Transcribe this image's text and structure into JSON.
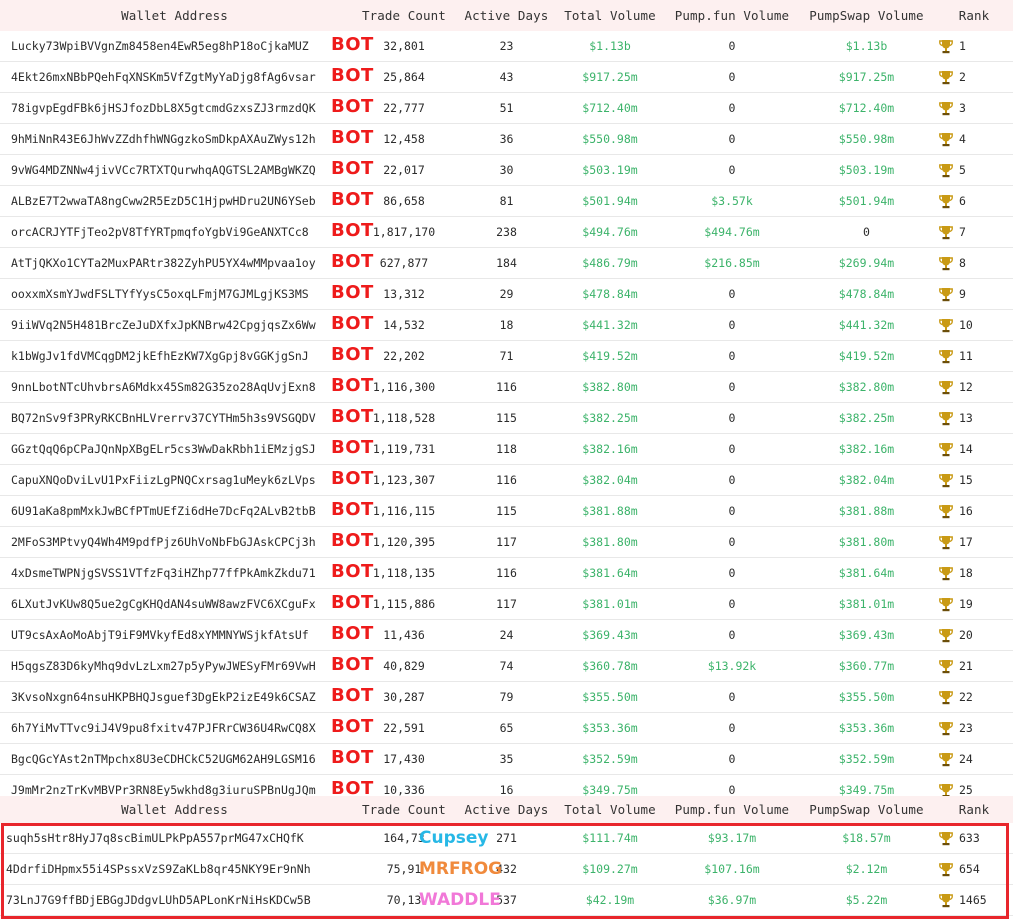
{
  "colors": {
    "green": "#3cb36a",
    "bot": "#ee1b1b",
    "frame": "#e8262c",
    "cupsey": "#27b8e6",
    "mrfrog": "#f08a3c",
    "waddle": "#f178d8",
    "trophy": "#c99a14"
  },
  "headers": {
    "wallet": "Wallet Address",
    "trades": "Trade Count",
    "days": "Active Days",
    "total": "Total Volume",
    "pump": "Pump.fun Volume",
    "swap": "PumpSwap Volume",
    "rank": "Rank"
  },
  "bot_label": "BOT",
  "top_rows": [
    {
      "addr": "Lucky73WpiBVVgnZm8458en4EwR5eg8hP18oCjkaMUZ",
      "trades": "32,801",
      "days": "23",
      "total": "$1.13b",
      "pump": "0",
      "swap": "$1.13b",
      "rank": "1"
    },
    {
      "addr": "4Ekt26mxNBbPQehFqXNSKm5VfZgtMyYaDjg8fAg6vsar",
      "trades": "25,864",
      "days": "43",
      "total": "$917.25m",
      "pump": "0",
      "swap": "$917.25m",
      "rank": "2"
    },
    {
      "addr": "78igvpEgdFBk6jHSJfozDbL8X5gtcmdGzxsZJ3rmzdQK",
      "trades": "22,777",
      "days": "51",
      "total": "$712.40m",
      "pump": "0",
      "swap": "$712.40m",
      "rank": "3"
    },
    {
      "addr": "9hMiNnR43E6JhWvZZdhfhWNGgzkoSmDkpAXAuZWys12h",
      "trades": "12,458",
      "days": "36",
      "total": "$550.98m",
      "pump": "0",
      "swap": "$550.98m",
      "rank": "4"
    },
    {
      "addr": "9vWG4MDZNNw4jivVCc7RTXTQurwhqAQGTSL2AMBgWKZQ",
      "trades": "22,017",
      "days": "30",
      "total": "$503.19m",
      "pump": "0",
      "swap": "$503.19m",
      "rank": "5"
    },
    {
      "addr": "ALBzE7T2wwaTA8ngCww2R5EzD5C1HjpwHDru2UN6YSeb",
      "trades": "86,658",
      "days": "81",
      "total": "$501.94m",
      "pump": "$3.57k",
      "swap": "$501.94m",
      "rank": "6"
    },
    {
      "addr": "orcACRJYTFjTeo2pV8TfYRTpmqfoYgbVi9GeANXTCc8",
      "trades": "1,817,170",
      "days": "238",
      "total": "$494.76m",
      "pump": "$494.76m",
      "swap": "0",
      "rank": "7"
    },
    {
      "addr": "AtTjQKXo1CYTa2MuxPARtr382ZyhPU5YX4wMMpvaa1oy",
      "trades": "627,877",
      "days": "184",
      "total": "$486.79m",
      "pump": "$216.85m",
      "swap": "$269.94m",
      "rank": "8"
    },
    {
      "addr": "ooxxmXsmYJwdFSLTYfYysC5oxqLFmjM7GJMLgjKS3MS",
      "trades": "13,312",
      "days": "29",
      "total": "$478.84m",
      "pump": "0",
      "swap": "$478.84m",
      "rank": "9"
    },
    {
      "addr": "9iiWVq2N5H481BrcZeJuDXfxJpKNBrw42CpgjqsZx6Ww",
      "trades": "14,532",
      "days": "18",
      "total": "$441.32m",
      "pump": "0",
      "swap": "$441.32m",
      "rank": "10"
    },
    {
      "addr": "k1bWgJv1fdVMCqgDM2jkEfhEzKW7XgGpj8vGGKjgSnJ",
      "trades": "22,202",
      "days": "71",
      "total": "$419.52m",
      "pump": "0",
      "swap": "$419.52m",
      "rank": "11"
    },
    {
      "addr": "9nnLbotNTcUhvbrsA6Mdkx45Sm82G35zo28AqUvjExn8",
      "trades": "1,116,300",
      "days": "116",
      "total": "$382.80m",
      "pump": "0",
      "swap": "$382.80m",
      "rank": "12"
    },
    {
      "addr": "BQ72nSv9f3PRyRKCBnHLVrerrv37CYTHm5h3s9VSGQDV",
      "trades": "1,118,528",
      "days": "115",
      "total": "$382.25m",
      "pump": "0",
      "swap": "$382.25m",
      "rank": "13"
    },
    {
      "addr": "GGztQqQ6pCPaJQnNpXBgELr5cs3WwDakRbh1iEMzjgSJ",
      "trades": "1,119,731",
      "days": "118",
      "total": "$382.16m",
      "pump": "0",
      "swap": "$382.16m",
      "rank": "14"
    },
    {
      "addr": "CapuXNQoDviLvU1PxFiizLgPNQCxrsag1uMeyk6zLVps",
      "trades": "1,123,307",
      "days": "116",
      "total": "$382.04m",
      "pump": "0",
      "swap": "$382.04m",
      "rank": "15"
    },
    {
      "addr": "6U91aKa8pmMxkJwBCfPTmUEfZi6dHe7DcFq2ALvB2tbB",
      "trades": "1,116,115",
      "days": "115",
      "total": "$381.88m",
      "pump": "0",
      "swap": "$381.88m",
      "rank": "16"
    },
    {
      "addr": "2MFoS3MPtvyQ4Wh4M9pdfPjz6UhVoNbFbGJAskCPCj3h",
      "trades": "1,120,395",
      "days": "117",
      "total": "$381.80m",
      "pump": "0",
      "swap": "$381.80m",
      "rank": "17"
    },
    {
      "addr": "4xDsmeTWPNjgSVSS1VTfzFq3iHZhp77ffPkAmkZkdu71",
      "trades": "1,118,135",
      "days": "116",
      "total": "$381.64m",
      "pump": "0",
      "swap": "$381.64m",
      "rank": "18"
    },
    {
      "addr": "6LXutJvKUw8Q5ue2gCgKHQdAN4suWW8awzFVC6XCguFx",
      "trades": "1,115,886",
      "days": "117",
      "total": "$381.01m",
      "pump": "0",
      "swap": "$381.01m",
      "rank": "19"
    },
    {
      "addr": "UT9csAxAoMoAbjT9iF9MVkyfEd8xYMMNYWSjkfAtsUf",
      "trades": "11,436",
      "days": "24",
      "total": "$369.43m",
      "pump": "0",
      "swap": "$369.43m",
      "rank": "20"
    },
    {
      "addr": "H5qgsZ83D6kyMhq9dvLzLxm27p5yPywJWESyFMr69VwH",
      "trades": "40,829",
      "days": "74",
      "total": "$360.78m",
      "pump": "$13.92k",
      "swap": "$360.77m",
      "rank": "21"
    },
    {
      "addr": "3KvsoNxgn64nsuHKPBHQJsguef3DgEkP2izE49k6CSAZ",
      "trades": "30,287",
      "days": "79",
      "total": "$355.50m",
      "pump": "0",
      "swap": "$355.50m",
      "rank": "22"
    },
    {
      "addr": "6h7YiMvTTvc9iJ4V9pu8fxitv47PJFRrCW36U4RwCQ8X",
      "trades": "22,591",
      "days": "65",
      "total": "$353.36m",
      "pump": "0",
      "swap": "$353.36m",
      "rank": "23"
    },
    {
      "addr": "BgcQGcYAst2nTMpchx8U3eCDHCkC52UGM62AH9LGSM16",
      "trades": "17,430",
      "days": "35",
      "total": "$352.59m",
      "pump": "0",
      "swap": "$352.59m",
      "rank": "24"
    },
    {
      "addr": "J9mMr2nzTrKvMBVPr3RN8Ey5wkhd8g3iuruSPBnUgJQm",
      "trades": "10,336",
      "days": "16",
      "total": "$349.75m",
      "pump": "0",
      "swap": "$349.75m",
      "rank": "25"
    }
  ],
  "bottom_rows": [
    {
      "addr": "suqh5sHtr8HyJ7q8scBimULPkPpA557prMG47xCHQfK",
      "trades": "164,73",
      "days": "271",
      "total": "$111.74m",
      "pump": "$93.17m",
      "swap": "$18.57m",
      "rank": "633",
      "tag": "Cupsey",
      "tag_color": "#27b8e6"
    },
    {
      "addr": "4DdrfiDHpmx55i4SPssxVzS9ZaKLb8qr45NKY9Er9nNh",
      "trades": "75,91",
      "days": "432",
      "total": "$109.27m",
      "pump": "$107.16m",
      "swap": "$2.12m",
      "rank": "654",
      "tag": "MRFROG",
      "tag_color": "#f08a3c"
    },
    {
      "addr": "73LnJ7G9ffBDjEBGgJDdgvLUhD5APLonKrNiHsKDCw5B",
      "trades": "70,13",
      "days": "537",
      "total": "$42.19m",
      "pump": "$36.97m",
      "swap": "$5.22m",
      "rank": "1465",
      "tag": "WADDLE",
      "tag_color": "#f178d8"
    }
  ]
}
